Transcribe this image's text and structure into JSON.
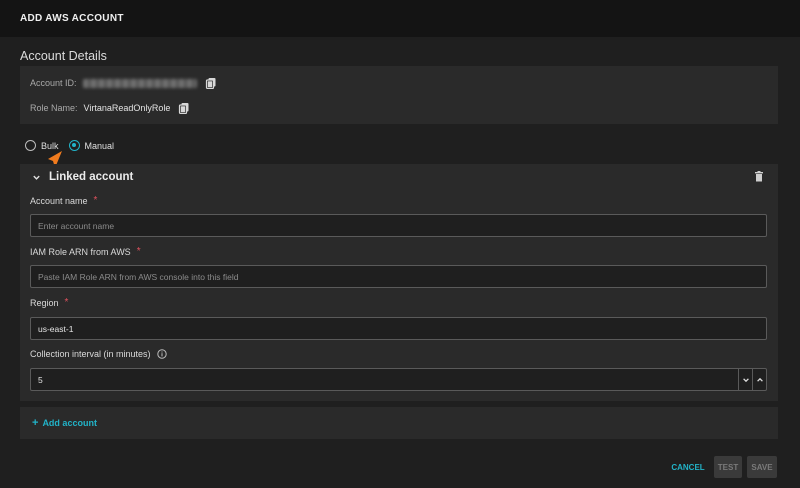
{
  "header": {
    "title": "ADD AWS ACCOUNT"
  },
  "account_details": {
    "title": "Account Details",
    "account_id_label": "Account ID:",
    "role_name_label": "Role Name:",
    "role_name_value": "VirtanaReadOnlyRole"
  },
  "mode": {
    "options": [
      {
        "label": "Bulk",
        "selected": false
      },
      {
        "label": "Manual",
        "selected": true
      }
    ]
  },
  "linked_account": {
    "title": "Linked account",
    "account_name": {
      "label": "Account name",
      "required": "*",
      "placeholder": "Enter account name"
    },
    "iam_role_arn": {
      "label": "IAM Role ARN from AWS",
      "required": "*",
      "placeholder": "Paste IAM Role ARN from AWS console into this field"
    },
    "region": {
      "label": "Region",
      "required": "*",
      "value": "us-east-1"
    },
    "collection_interval": {
      "label": "Collection interval (in minutes)",
      "value": "5"
    }
  },
  "add_account": {
    "plus": "+",
    "label": "Add account"
  },
  "footer": {
    "cancel": "CANCEL",
    "test": "TEST",
    "save": "SAVE"
  },
  "colors": {
    "accent": "#22b3c8",
    "required": "#e0525e",
    "cursor": "#f07b1e"
  }
}
